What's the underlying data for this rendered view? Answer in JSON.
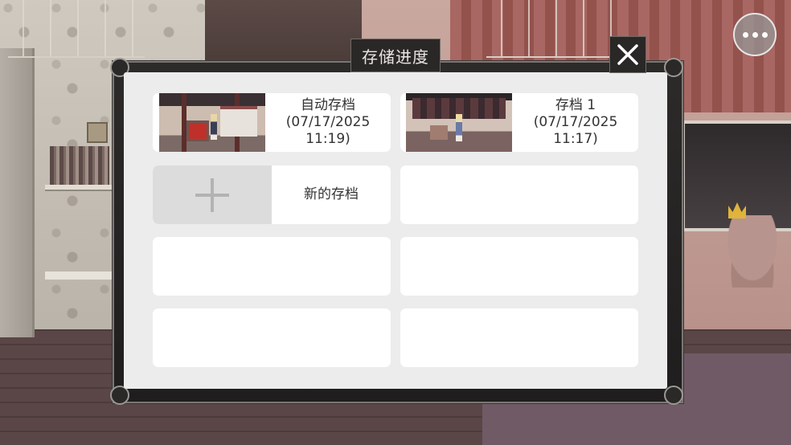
{
  "dialog": {
    "title": "存储进度"
  },
  "slots": [
    {
      "name": "自动存档",
      "date": "(07/17/2025",
      "time": "11:19)"
    },
    {
      "name": "存档 1",
      "date": "(07/17/2025",
      "time": "11:17)"
    }
  ],
  "new_save": {
    "label": "新的存档"
  },
  "icons": {
    "close": "close-icon",
    "menu": "more-dots-icon",
    "add": "plus-icon"
  },
  "colors": {
    "panel_bg": "#ececec",
    "slot_bg": "#ffffff",
    "frame_dark": "#2a2727",
    "text": "#333333"
  }
}
